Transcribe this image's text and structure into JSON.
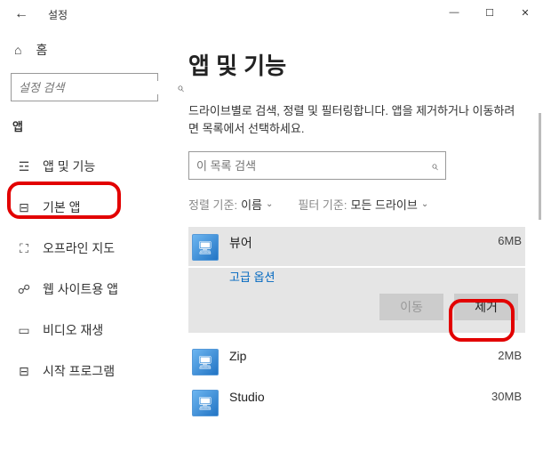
{
  "window": {
    "title": "설정",
    "back": "←",
    "min": "—",
    "max": "☐",
    "close": "✕"
  },
  "sidebar": {
    "home_label": "홈",
    "search_placeholder": "설정 검색",
    "category": "앱",
    "items": [
      {
        "label": "앱 및 기능"
      },
      {
        "label": "기본 앱"
      },
      {
        "label": "오프라인 지도"
      },
      {
        "label": "웹 사이트용 앱"
      },
      {
        "label": "비디오 재생"
      },
      {
        "label": "시작 프로그램"
      }
    ]
  },
  "main": {
    "title": "앱 및 기능",
    "description": "드라이브별로 검색, 정렬 및 필터링합니다. 앱을 제거하거나 이동하려면 목록에서 선택하세요.",
    "search_placeholder": "이 목록 검색",
    "sort_label": "정렬 기준:",
    "sort_value": "이름",
    "filter_label": "필터 기준:",
    "filter_value": "모든 드라이브",
    "selected": {
      "name": "뷰어",
      "size": "6MB",
      "advanced": "고급 옵션",
      "move": "이동",
      "uninstall": "제거"
    },
    "apps": [
      {
        "name": "Zip",
        "size": "2MB"
      },
      {
        "name": "Studio",
        "size": "30MB"
      }
    ]
  }
}
